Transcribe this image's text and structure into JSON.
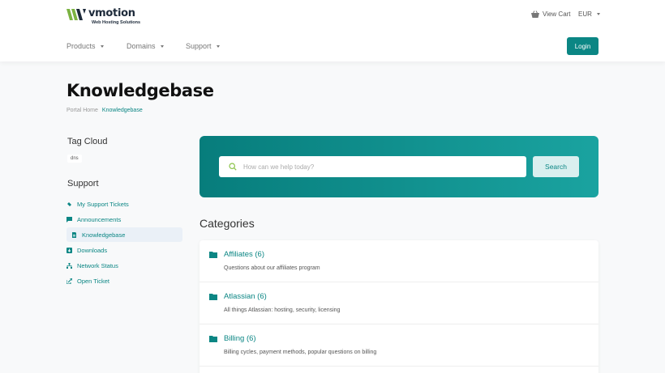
{
  "header": {
    "brand": "vmotion",
    "tagline": "Web Hosting Solutions",
    "cart_label": "View Cart",
    "currency": "EUR",
    "nav": [
      {
        "label": "Products"
      },
      {
        "label": "Domains"
      },
      {
        "label": "Support"
      }
    ],
    "login_label": "Login"
  },
  "page": {
    "title": "Knowledgebase",
    "breadcrumb": [
      "Portal Home",
      "Knowledgebase"
    ]
  },
  "sidebar": {
    "tag_cloud_title": "Tag Cloud",
    "tags": [
      "dns"
    ],
    "support_title": "Support",
    "items": [
      {
        "label": "My Support Tickets",
        "icon": "ticket-icon"
      },
      {
        "label": "Announcements",
        "icon": "comment-icon"
      },
      {
        "label": "Knowledgebase",
        "icon": "document-icon",
        "active": true
      },
      {
        "label": "Downloads",
        "icon": "download-icon"
      },
      {
        "label": "Network Status",
        "icon": "network-icon"
      },
      {
        "label": "Open Ticket",
        "icon": "open-ticket-icon"
      }
    ]
  },
  "search": {
    "placeholder": "How can we help today?",
    "button_label": "Search"
  },
  "categories": {
    "title": "Categories",
    "items": [
      {
        "title": "Affiliates (6)",
        "description": "Questions about our affiliates program"
      },
      {
        "title": "Atlassian (6)",
        "description": "All things Atlassian: hosting, security, licensing"
      },
      {
        "title": "Billing (6)",
        "description": "Billing cycles, payment methods, popular questions on billing"
      }
    ]
  },
  "colors": {
    "accent": "#0b8684",
    "banner_start": "#077d7c",
    "banner_end": "#1aa3a0"
  }
}
